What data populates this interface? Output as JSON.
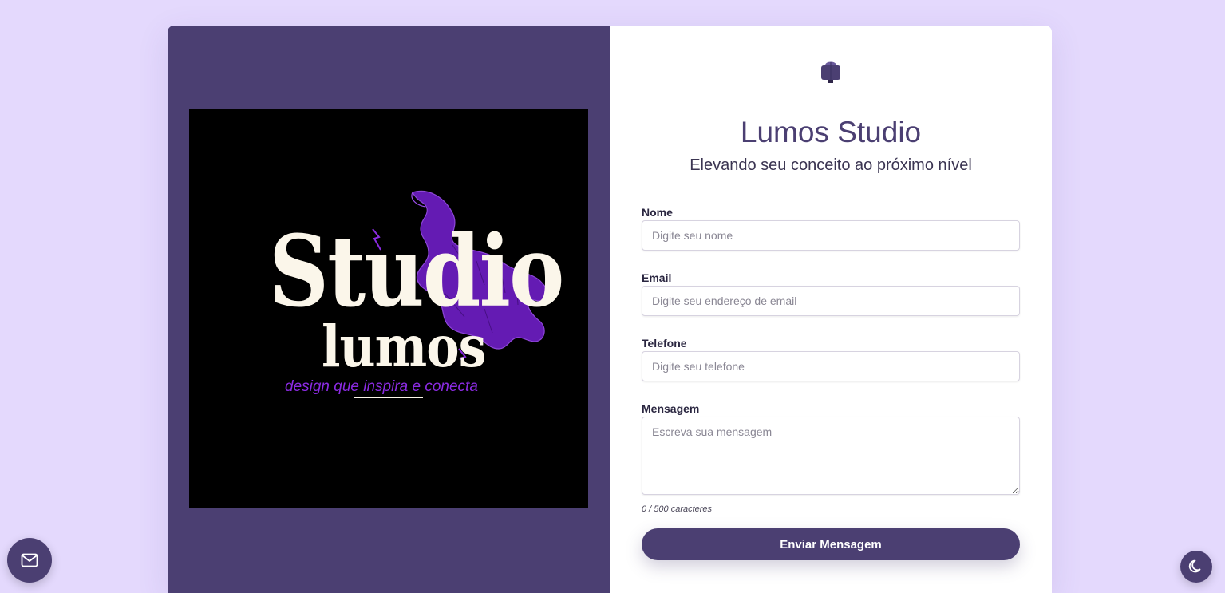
{
  "brand": {
    "title": "Lumos Studio",
    "subtitle": "Elevando seu conceito ao próximo nível",
    "icon": "brand-icon",
    "colors": {
      "primary": "#4b3f72",
      "background": "#e4d9fd",
      "accent": "#8b2be2",
      "logo_text": "#fbf6ea"
    }
  },
  "logo": {
    "line1": "Studio",
    "line2": "lumos",
    "tagline": "design que inspira e conecta"
  },
  "form": {
    "fields": [
      {
        "label": "Nome",
        "placeholder": "Digite seu nome",
        "value": ""
      },
      {
        "label": "Email",
        "placeholder": "Digite seu endereço de email",
        "value": ""
      },
      {
        "label": "Telefone",
        "placeholder": "Digite seu telefone",
        "value": ""
      }
    ],
    "message": {
      "label": "Mensagem",
      "placeholder": "Escreva sua mensagem",
      "value": ""
    },
    "counter": "0 / 500 caracteres",
    "submit_label": "Enviar Mensagem"
  },
  "floating": {
    "contact_icon": "mail-icon",
    "theme_icon": "moon-icon"
  }
}
